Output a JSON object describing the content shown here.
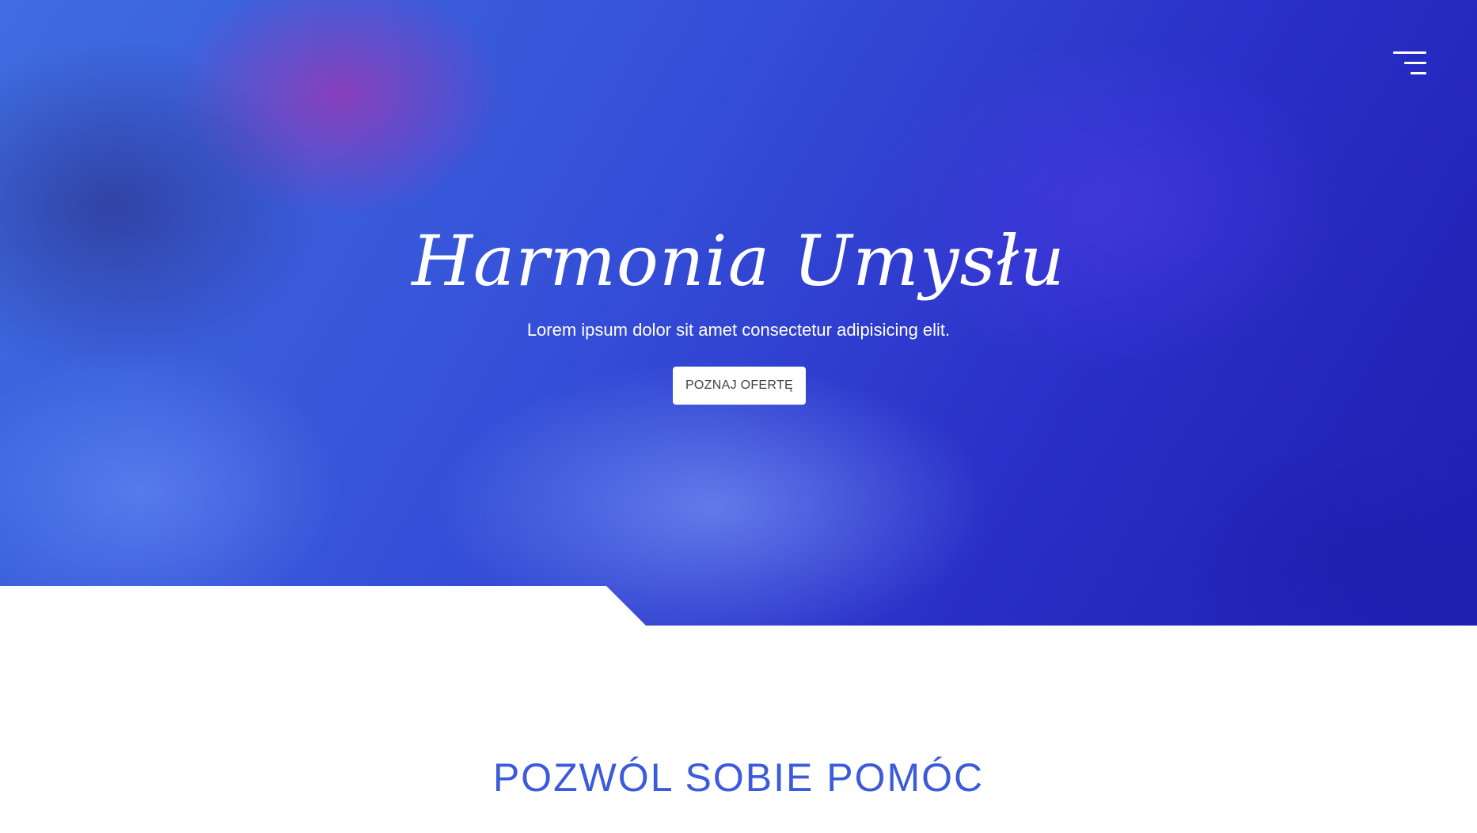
{
  "hero": {
    "title": "Harmonia Umysłu",
    "subtitle": "Lorem ipsum dolor sit amet consectetur adipisicing elit.",
    "cta_label": "POZNAJ OFERTĘ",
    "menu_icon": "hamburger-menu-icon"
  },
  "section": {
    "title": "POZWÓL SOBIE POMÓC"
  },
  "colors": {
    "hero_overlay": "#3550d8",
    "accent": "#3b5bdb",
    "button_bg": "#ffffff"
  }
}
